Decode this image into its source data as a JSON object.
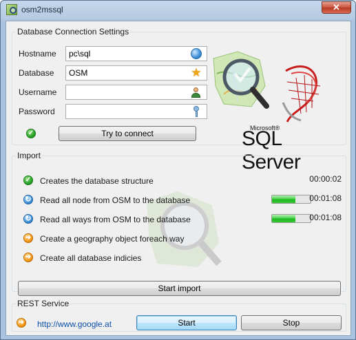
{
  "window": {
    "title": "osm2mssql",
    "close_glyph": "✕"
  },
  "db": {
    "legend": "Database Connection Settings",
    "hostname_label": "Hostname",
    "hostname_value": "pc\\sql",
    "database_label": "Database",
    "database_value": "OSM",
    "username_label": "Username",
    "username_value": "",
    "password_label": "Password",
    "password_value": "",
    "connect_label": "Try to connect",
    "icons": [
      "globe-icon",
      "star-icon",
      "user-icon",
      "key-icon",
      "check-icon"
    ]
  },
  "logo": {
    "microsoft": "Microsoft®",
    "product": "SQL Server"
  },
  "import": {
    "legend": "Import",
    "steps": [
      {
        "label": "Creates the database structure",
        "status": "done",
        "time": "00:00:02"
      },
      {
        "label": "Read all node from OSM to the database",
        "status": "running",
        "time": "00:01:08",
        "progress": 0.6
      },
      {
        "label": "Read all ways from OSM to the database",
        "status": "running",
        "time": "00:01:08",
        "progress": 0.6
      },
      {
        "label": "Create a geography object foreach way",
        "status": "pending",
        "time": ""
      },
      {
        "label": "Create all database indicies",
        "status": "pending",
        "time": ""
      }
    ],
    "start_label": "Start import"
  },
  "rest": {
    "legend": "REST Service",
    "url": "http://www.google.at",
    "start_label": "Start",
    "stop_label": "Stop"
  },
  "colors": {
    "accent": "#3c7fb1",
    "progress": "#1fb91f",
    "link": "#0b4fa8"
  }
}
